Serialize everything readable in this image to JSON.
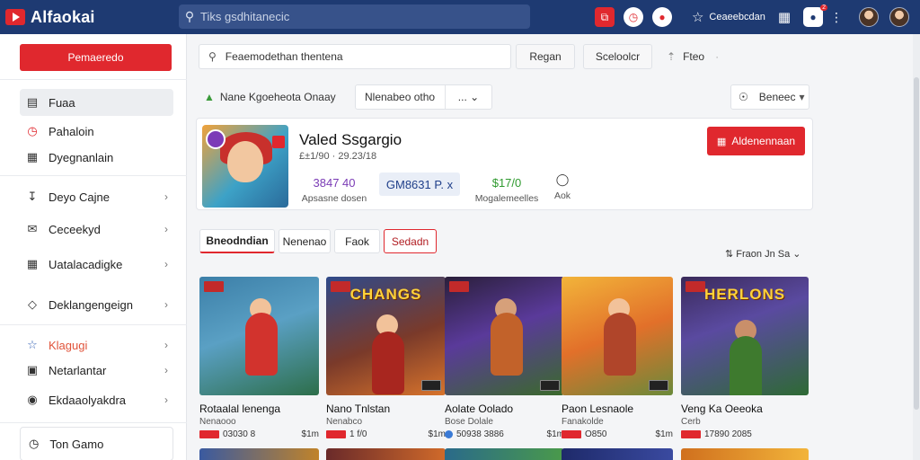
{
  "app": {
    "title": "Alfaokai"
  },
  "topbar": {
    "search_placeholder": "Tiks gsdhitanecic",
    "link_label": "Ceaeebcdan",
    "notif_badge": "2"
  },
  "sidebar": {
    "primary_button": "Pemaeredo",
    "items": [
      {
        "label": "Fuaa",
        "icon": "home-icon",
        "chevron": false
      },
      {
        "label": "Pahaloin",
        "icon": "clock-icon",
        "chevron": false
      },
      {
        "label": "Dyegnanlain",
        "icon": "grid-icon",
        "chevron": false
      },
      {
        "label": "Deyo Cajne",
        "icon": "download-icon",
        "chevron": true
      },
      {
        "label": "Ceceekyd",
        "icon": "mail-icon",
        "chevron": true
      },
      {
        "label": "Uatalacadigke",
        "icon": "calendar-icon",
        "chevron": true
      },
      {
        "label": "Deklangengeign",
        "icon": "tag-icon",
        "chevron": true
      },
      {
        "label": "Klagugi",
        "icon": "star-icon",
        "chevron": true
      },
      {
        "label": "Netarlantar",
        "icon": "image-icon",
        "chevron": true
      },
      {
        "label": "Ekdaaolyakdra",
        "icon": "circle-icon",
        "chevron": true
      }
    ],
    "bottom_label": "Ton Gamo"
  },
  "filters": {
    "search_value": "Feaemodethan thentena",
    "btn1": "Regan",
    "btn2": "Sceloolcr",
    "btn3": "Fteo",
    "tag1": "Nane Kgoeheota Onaay",
    "tag2": "Nlenabeo otho",
    "tag2_more": "...",
    "right_select": "Beneec"
  },
  "featured": {
    "title": "Valed Ssgargio",
    "meta": "£±1/90 · 29.23/18",
    "stat1_value": "3847 40",
    "stat1_label": "Apsasne dosen",
    "chip": "GM8631 P. x",
    "stat2_value": "$17/0",
    "stat2_label": "Mogalemeelles",
    "stat3_label": "Aok",
    "install_label": "Aldenennaan"
  },
  "tabs": [
    "Bneodndian",
    "Nenenao",
    "Faok",
    "Sedadn"
  ],
  "sort_label": "Fraon Jn Sa",
  "games": [
    {
      "name": "Rotaalal lenenga",
      "sub": "Nenaooo",
      "price": "03030 8",
      "right": "$1m"
    },
    {
      "name": "Nano Tnlstan",
      "sub": "Nenabco",
      "price": "1 f/0",
      "right": "$1m"
    },
    {
      "name": "Aolate Oolado",
      "sub": "Bose Dolale",
      "price": "50938 3886",
      "right": "$1m"
    },
    {
      "name": "Paon Lesnaole",
      "sub": "Fanakolde",
      "price": "O850",
      "right": "$1m"
    },
    {
      "name": "Veng Ka Oeeoka",
      "sub": "Cerb",
      "price": "17890 2085",
      "right": ""
    }
  ],
  "game_titles": [
    "",
    "CHANGS",
    "",
    "",
    "HERLONS"
  ],
  "colors": {
    "brand": "#1e3a72",
    "accent": "#e0282e"
  }
}
